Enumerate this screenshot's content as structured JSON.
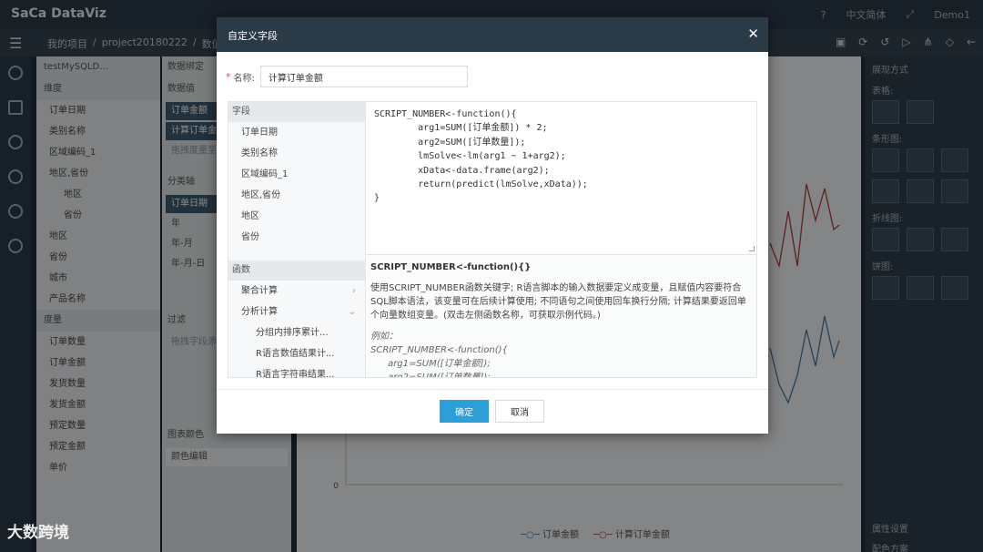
{
  "app": {
    "logo": "SaCa DataViz",
    "language": "中文简体",
    "user": "Demo1"
  },
  "breadcrumb": [
    "我的项目",
    "/",
    "project20180222",
    "/",
    "数值"
  ],
  "datasource": "testMySQLD...",
  "fields_panel": {
    "dimension_header": "维度",
    "dimensions": [
      "订单日期",
      "类别名称",
      "区域编码_1",
      "地区,省份",
      "地区",
      "省份",
      "地区",
      "省份",
      "城市",
      "产品名称"
    ],
    "measure_header": "度量",
    "measures": [
      "订单数量",
      "订单金额",
      "发货数量",
      "发货金额",
      "预定数量",
      "预定金额",
      "单价"
    ]
  },
  "binding_panel": {
    "data_binding": "数据绑定",
    "values_header": "数据值",
    "values": [
      "订单金额",
      "计算订单金"
    ],
    "drop_hint": "拖拽度量至",
    "category_header": "分类轴",
    "category_value": "订单日期",
    "category_items": [
      "年",
      "年-月",
      "年-月-日"
    ],
    "filter_header": "过滤",
    "filter_hint": "拖拽字段添",
    "color_header": "图表颜色",
    "color_edit": "颜色编辑"
  },
  "chart": {
    "legend": [
      "订单金额",
      "计算订单金额"
    ],
    "y_zero_label": "0"
  },
  "right_panel": {
    "title": "展现方式",
    "sections": [
      "表格:",
      "条形图:",
      "折线图:",
      "饼图:"
    ],
    "footer_items": [
      "属性设置",
      "配色方案"
    ]
  },
  "modal": {
    "title": "自定义字段",
    "name_label": "名称:",
    "name_value": "计算订单金额",
    "fields_header": "字段",
    "fields": [
      "订单日期",
      "类别名称",
      "区域编码_1",
      "地区,省份",
      "地区",
      "省份"
    ],
    "functions_header": "函数",
    "functions": [
      {
        "label": "聚合计算"
      },
      {
        "label": "分析计算"
      }
    ],
    "function_subitems": [
      "分组内排序累计...",
      "R语言数值结果计...",
      "R语言字符串结果..."
    ],
    "code": "SCRIPT_NUMBER<-function(){\n        arg1=SUM([订单金额]) * 2;\n        arg2=SUM([订单数量]);\n        lmSolve<-lm(arg1 ~ 1+arg2);\n        xData<-data.frame(arg2);\n        return(predict(lmSolve,xData));\n}",
    "help_title": "SCRIPT_NUMBER<-function(){}",
    "help_text": "使用SCRIPT_NUMBER函数关键字; R语言脚本的输入数据要定义成变量，且赋值内容要符合SQL脚本语法，该变量可在后续计算使用; 不同语句之间使用回车换行分隔; 计算结果要返回单个向量数组变量。(双击左侧函数名称，可获取示例代码。)",
    "help_example": "例如：\nSCRIPT_NUMBER<-function(){\n      arg1=SUM([订单金额]);\n      arg2=SUM([订单数量]);",
    "ok_label": "确定",
    "cancel_label": "取消",
    "close_symbol": "✕"
  },
  "watermark": "大数跨境"
}
